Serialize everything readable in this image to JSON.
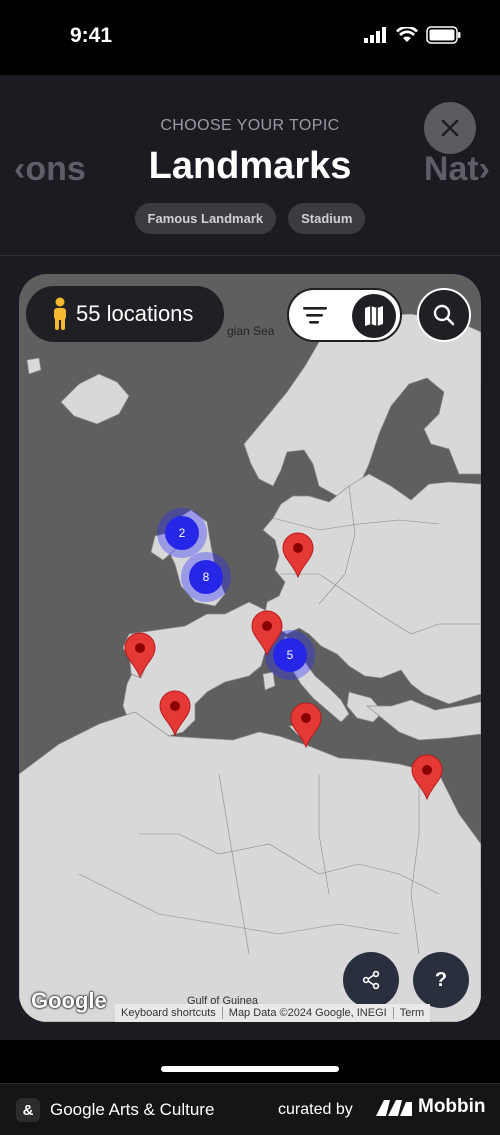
{
  "status_bar": {
    "time": "9:41"
  },
  "header": {
    "kicker": "CHOOSE YOUR TOPIC",
    "title": "Landmarks",
    "prev_topic": "‹ons",
    "next_topic": "Nat›",
    "chips": [
      "Famous Landmark",
      "Stadium"
    ]
  },
  "map": {
    "locations_count": "55 locations",
    "sea_label": "gian Sea",
    "gulf_label": "Gulf of Guinea",
    "clusters": [
      "2",
      "8",
      "5"
    ],
    "google_logo": "Google",
    "attribution": {
      "shortcuts": "Keyboard shortcuts",
      "data": "Map Data ©2024 Google, INEGI",
      "terms": "Term"
    },
    "help_label": "?"
  },
  "footer": {
    "app_name": "Google Arts & Culture",
    "curated_by": "curated by",
    "mobbin": "Mobbin"
  },
  "colors": {
    "pin_red": "#e53935",
    "cluster_blue": "#2626e8",
    "land": "#d9d8d9",
    "water": "#5f5f5f"
  }
}
